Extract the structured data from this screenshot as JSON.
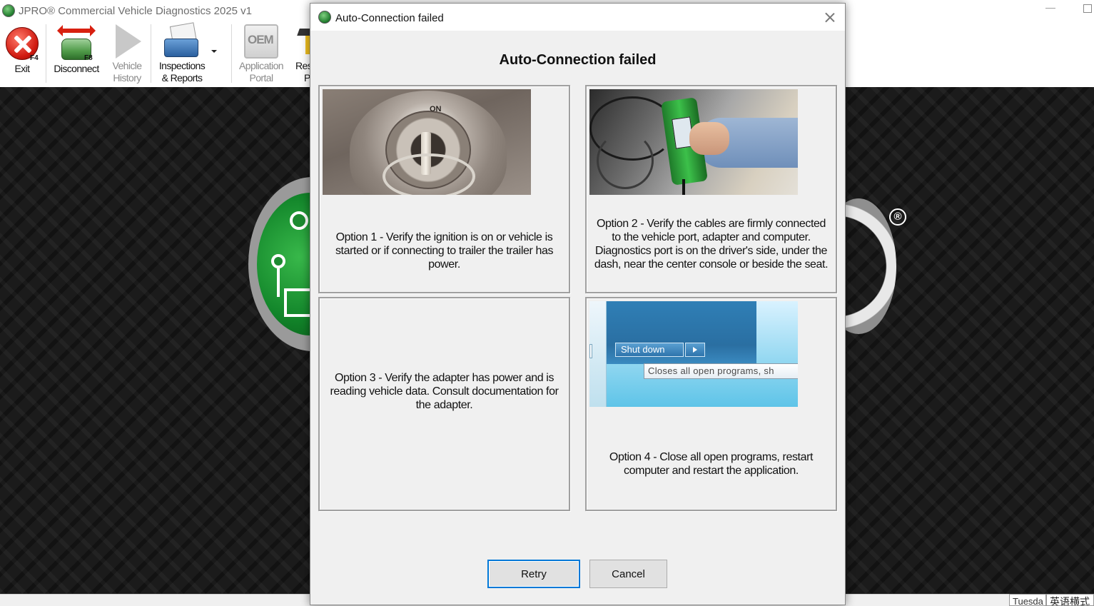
{
  "app": {
    "title": "JPRO® Commercial Vehicle Diagnostics 2025 v1",
    "window_controls": {
      "minimize": "—"
    }
  },
  "toolbar": {
    "exit": {
      "label": "Exit",
      "fkey": "F4"
    },
    "disconnect": {
      "label": "Disconnect",
      "fkey": "F8"
    },
    "vehicle_history": {
      "label_line1": "Vehicle",
      "label_line2": "History"
    },
    "inspections": {
      "label_line1": "Inspections",
      "label_line2": "& Reports"
    },
    "application_portal": {
      "icon_text": "OEM",
      "label_line1": "Application",
      "label_line2": "Portal"
    },
    "resources": {
      "label_line1": "Res",
      "label_line2": "P"
    }
  },
  "background": {
    "registered_mark": "®"
  },
  "dialog": {
    "title": "Auto-Connection failed",
    "heading": "Auto-Connection failed",
    "options": [
      {
        "text": "Option 1 - Verify the ignition is on or vehicle is started or if connecting to trailer the trailer has power.",
        "image_text": "ON"
      },
      {
        "text": "Option 2 - Verify the cables are firmly connected to the vehicle port, adapter and computer.  Diagnostics port is on the driver's side, under the dash, near the center console or beside the seat."
      },
      {
        "text": "Option 3 - Verify the adapter has power and is reading vehicle data.  Consult documentation for the adapter."
      },
      {
        "text": "Option 4 - Close all open programs, restart computer and restart the application.",
        "image_button": "Shut down",
        "image_tooltip": "Closes all open programs, sh"
      }
    ],
    "buttons": {
      "retry": "Retry",
      "cancel": "Cancel"
    }
  },
  "taskbar": {
    "date_fragment": "Tuesda",
    "ime_fragment": "英语横式"
  },
  "colors": {
    "accent": "#0078d7",
    "dialog_bg": "#f0f0f0",
    "exit_red": "#d01a10",
    "jpro_green": "#1e7a2c"
  }
}
